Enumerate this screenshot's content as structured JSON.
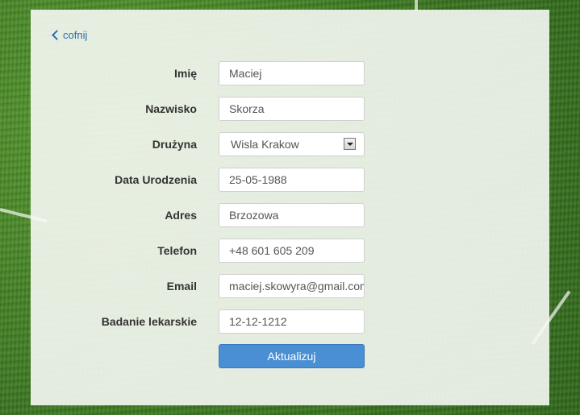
{
  "back_link": {
    "label": "cofnij",
    "icon": "chevron-left-icon"
  },
  "form": {
    "fields": [
      {
        "label": "Imię",
        "value": "Maciej"
      },
      {
        "label": "Nazwisko",
        "value": "Skorza"
      },
      {
        "label": "Drużyna",
        "value": "Wisla Krakow",
        "type": "select"
      },
      {
        "label": "Data Urodzenia",
        "value": "25-05-1988"
      },
      {
        "label": "Adres",
        "value": "Brzozowa"
      },
      {
        "label": "Telefon",
        "value": "+48 601 605 209"
      },
      {
        "label": "Email",
        "value": "maciej.skowyra@gmail.com"
      },
      {
        "label": "Badanie lekarskie",
        "value": "12-12-1212"
      }
    ],
    "submit_label": "Aktualizuj"
  },
  "colors": {
    "accent": "#4a8fd3",
    "link": "#2a6db5",
    "background": "#3d7a22"
  }
}
